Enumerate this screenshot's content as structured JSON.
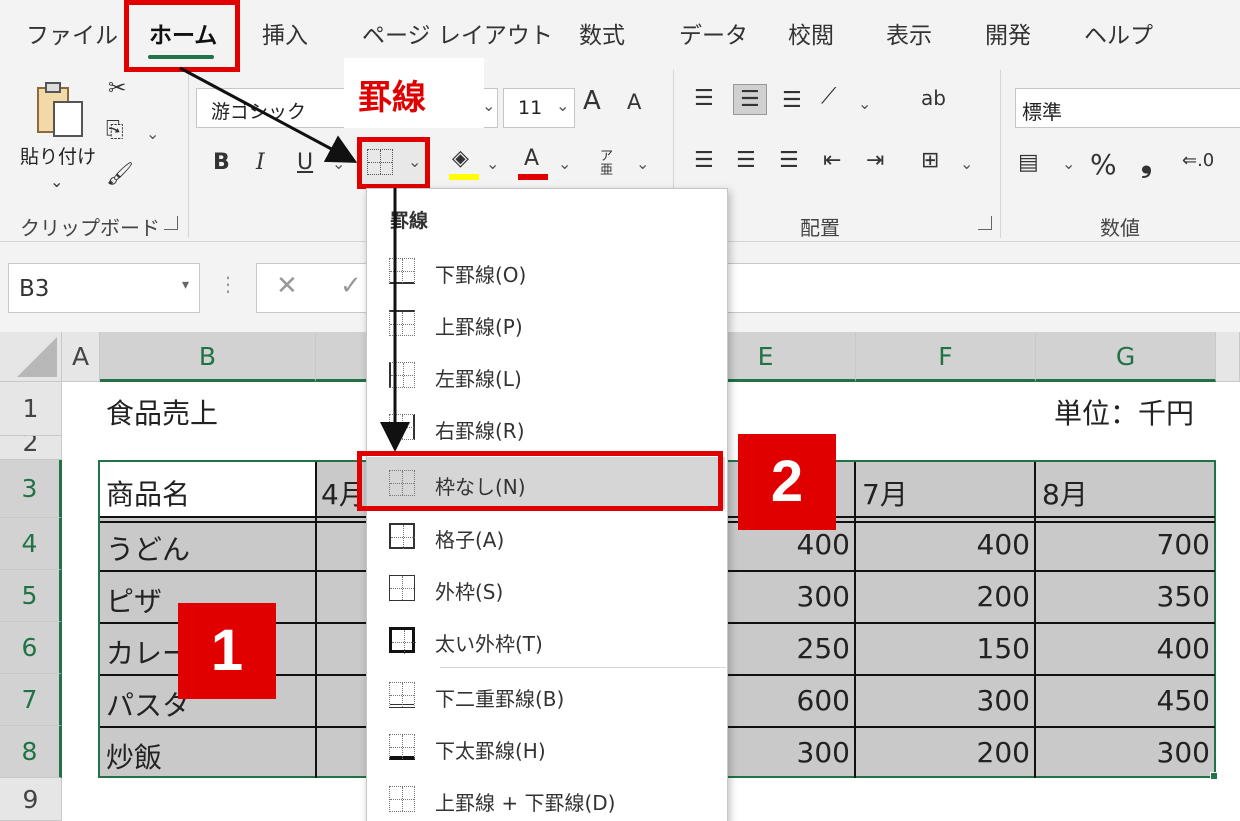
{
  "ribbon_tabs": [
    "ファイル",
    "ホーム",
    "挿入",
    "ページ レイアウト",
    "数式",
    "データ",
    "校閲",
    "表示",
    "開発",
    "ヘルプ"
  ],
  "ribbon": {
    "paste_label": "貼り付け",
    "clipboard_group": "クリップボード",
    "font_name": "游ゴシック",
    "font_size": "11",
    "grow_font": "A",
    "shrink_font": "A",
    "bold": "B",
    "italic": "I",
    "underline": "U",
    "furigana": "ア亜",
    "alignment_group": "配置",
    "number_group": "数値",
    "number_format": "標準",
    "percent": "%",
    "comma": "❟",
    "highlight_color": "#ffff00",
    "font_color": "#e00000",
    "accent_color": "#217346"
  },
  "callout_label": "罫線",
  "formula_bar": {
    "name_box": "B3",
    "cancel": "✕",
    "enter": "✓"
  },
  "columns": [
    "A",
    "B",
    "E",
    "F",
    "G"
  ],
  "rows": [
    "1",
    "2",
    "3",
    "4",
    "5",
    "6",
    "7",
    "8",
    "9"
  ],
  "sheet": {
    "title": "食品売上",
    "unit": "単位：千円",
    "header": [
      "商品名",
      "4月",
      "7月",
      "8月"
    ],
    "items": [
      {
        "name": "うどん",
        "e": "400",
        "f": "400",
        "g": "700"
      },
      {
        "name": "ピザ",
        "e": "300",
        "f": "200",
        "g": "350"
      },
      {
        "name": "カレー",
        "e": "250",
        "f": "150",
        "g": "400"
      },
      {
        "name": "パスタ",
        "e": "600",
        "f": "300",
        "g": "450"
      },
      {
        "name": "炒飯",
        "e": "300",
        "f": "200",
        "g": "300"
      }
    ]
  },
  "border_menu": {
    "title": "罫線",
    "items": [
      "下罫線(O)",
      "上罫線(P)",
      "左罫線(L)",
      "右罫線(R)",
      "枠なし(N)",
      "格子(A)",
      "外枠(S)",
      "太い外枠(T)",
      "下二重罫線(B)",
      "下太罫線(H)",
      "上罫線 + 下罫線(D)"
    ]
  },
  "badges": [
    "1",
    "2"
  ]
}
